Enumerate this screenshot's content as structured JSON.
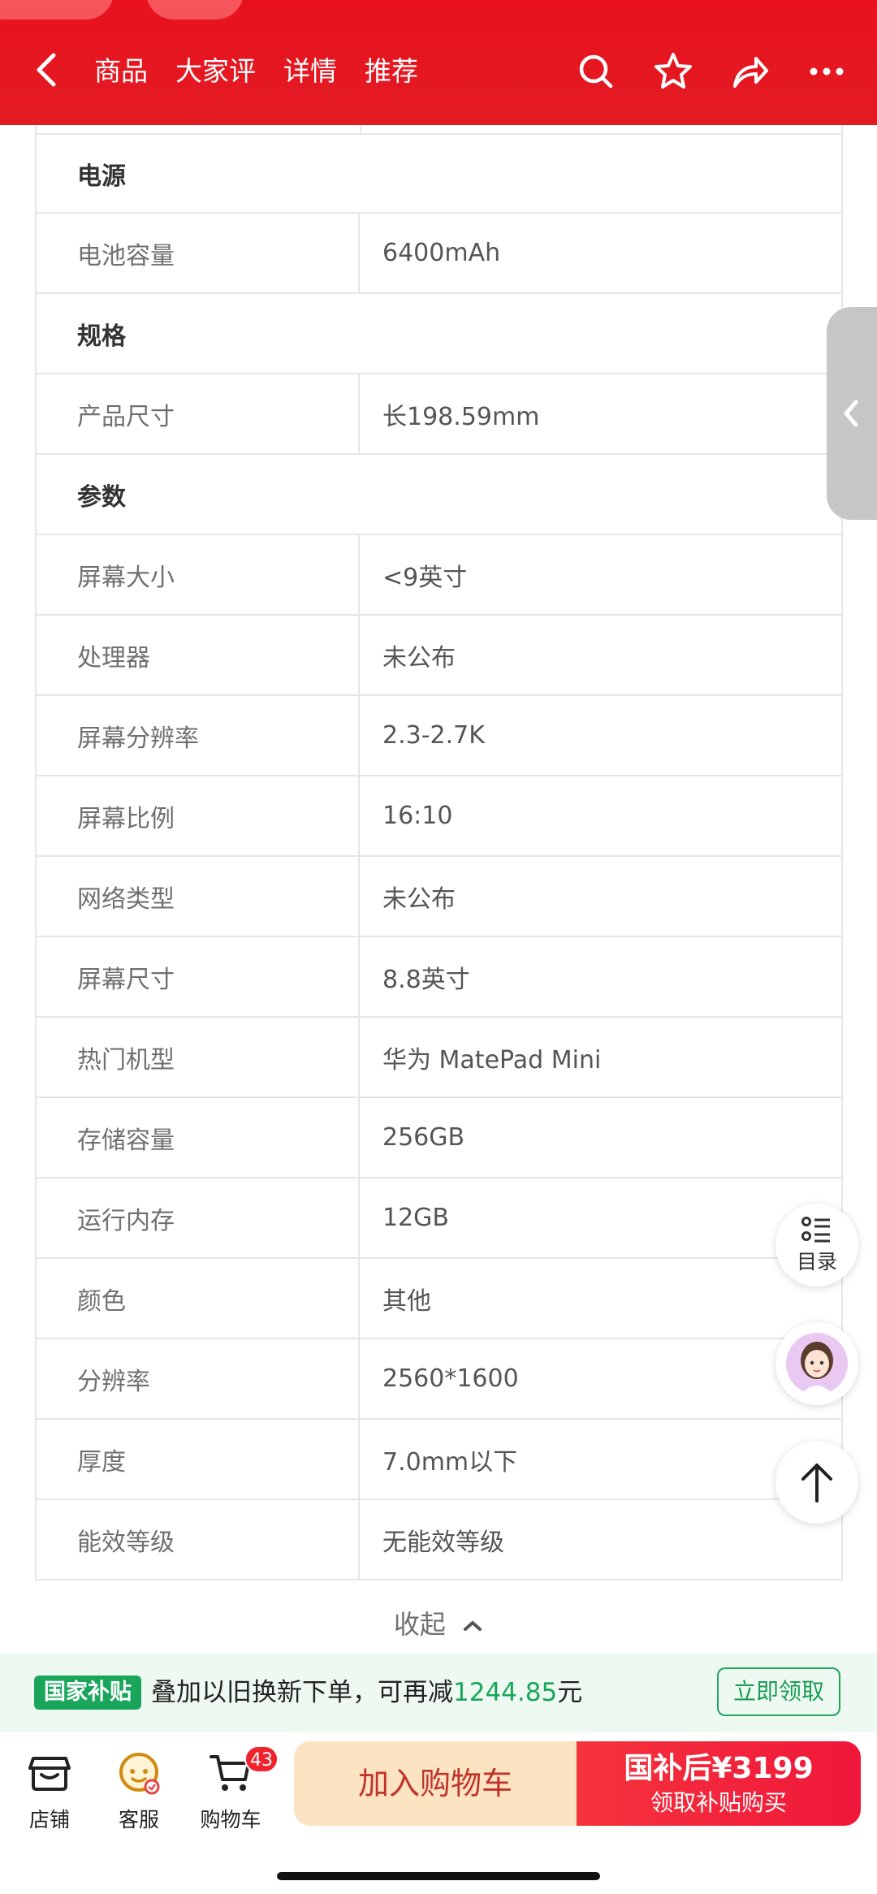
{
  "header": {
    "tabs": [
      "商品",
      "大家评",
      "详情",
      "推荐"
    ]
  },
  "spec": {
    "groups": [
      {
        "title": "电源",
        "rows": [
          [
            "电池容量",
            "6400mAh"
          ]
        ]
      },
      {
        "title": "规格",
        "rows": [
          [
            "产品尺寸",
            "长198.59mm"
          ]
        ]
      },
      {
        "title": "参数",
        "rows": [
          [
            "屏幕大小",
            "<9英寸"
          ],
          [
            "处理器",
            "未公布"
          ],
          [
            "屏幕分辨率",
            "2.3-2.7K"
          ],
          [
            "屏幕比例",
            "16:10"
          ],
          [
            "网络类型",
            "未公布"
          ],
          [
            "屏幕尺寸",
            "8.8英寸"
          ],
          [
            "热门机型",
            "华为 MatePad Mini"
          ],
          [
            "存储容量",
            "256GB"
          ],
          [
            "运行内存",
            "12GB"
          ],
          [
            "颜色",
            "其他"
          ],
          [
            "分辨率",
            "2560*1600"
          ],
          [
            "厚度",
            "7.0mm以下"
          ],
          [
            "能效等级",
            "无能效等级"
          ]
        ]
      }
    ],
    "collapse_label": "收起"
  },
  "float": {
    "toc_label": "目录"
  },
  "banner": {
    "badge": "国家补贴",
    "text_prefix": "叠加以旧换新下单，可再减",
    "amount": "1244.85",
    "text_suffix": "元",
    "button": "立即领取"
  },
  "bottom": {
    "store": "店铺",
    "service": "客服",
    "cart": "购物车",
    "cart_count": "43",
    "add_to_cart": "加入购物车",
    "buy_line1": "国补后¥3199",
    "buy_line2": "领取补贴购买"
  },
  "colors": {
    "brand_red": "#e31b23",
    "subsidy_green": "#19a65b"
  }
}
